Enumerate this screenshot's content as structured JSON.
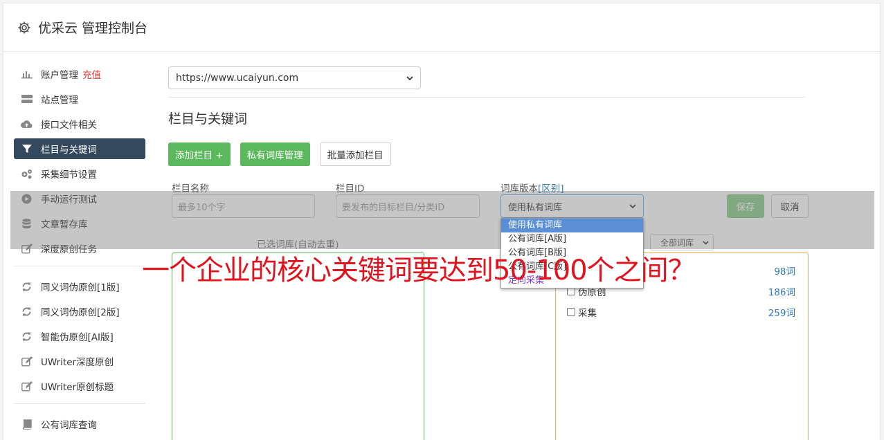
{
  "header": {
    "title": "优采云 管理控制台"
  },
  "sidebar": {
    "items": [
      {
        "label": "账户管理",
        "badge": "充值"
      },
      {
        "label": "站点管理"
      },
      {
        "label": "接口文件相关"
      },
      {
        "label": "栏目与关键词",
        "active": true
      },
      {
        "label": "采集细节设置"
      },
      {
        "label": "手动运行测试"
      },
      {
        "label": "文章暂存库"
      },
      {
        "label": "深度原创任务"
      },
      {
        "label": "同义词伪原创[1版]"
      },
      {
        "label": "同义词伪原创[2版]"
      },
      {
        "label": "智能伪原创[AI版]"
      },
      {
        "label": "UWriter深度原创"
      },
      {
        "label": "UWriter原创标题"
      },
      {
        "label": "公有词库查询"
      }
    ]
  },
  "main": {
    "site_select": "https://www.ucaiyun.com",
    "section_title": "栏目与关键词",
    "buttons": {
      "add_column": "添加栏目 +",
      "private_lib": "私有词库管理",
      "batch_add": "批量添加栏目"
    },
    "form": {
      "label_name": "栏目名称",
      "label_id": "栏目ID",
      "label_version": "词库版本",
      "label_diff": "[区别]",
      "placeholder_name": "最多10个字",
      "placeholder_id": "要发布的目标栏目/分类ID",
      "version_value": "使用私有词库",
      "save": "保存",
      "cancel": "取消"
    },
    "selected_label": "已选词库(自动去重)",
    "lib_filter": "全部词库",
    "dropdown_options": [
      "使用私有词库",
      "公有词库[A版]",
      "公有词库[B版]",
      "公有词库[C版]",
      "定向采集"
    ],
    "libraries": [
      {
        "name": "",
        "count": "98词"
      },
      {
        "name": "伪原创",
        "count": "186词"
      },
      {
        "name": "采集",
        "count": "259词"
      }
    ]
  },
  "caption": "一个企业的核心关键词要达到50-100个之间？",
  "colors": {
    "active_nav": "#34495e",
    "green": "#5cb85c",
    "caption_red": "#e0141e",
    "link_blue": "#337ab7"
  }
}
